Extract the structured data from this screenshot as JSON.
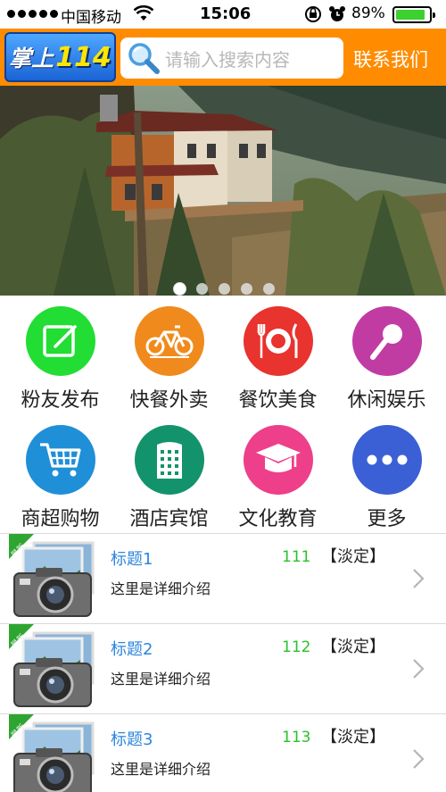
{
  "status_bar": {
    "carrier": "中国移动",
    "time": "15:06",
    "battery_percent": "89%",
    "battery_level": 0.89
  },
  "header": {
    "logo_text_1": "掌上",
    "logo_text_2": "114",
    "search_placeholder": "请输入搜索内容",
    "contact_label": "联系我们",
    "bar_color": "#ff8c00"
  },
  "banner": {
    "slide_count": 5,
    "active_slide": 1
  },
  "categories": [
    {
      "label": "粉友发布",
      "icon": "edit-icon",
      "color": "#22dd33"
    },
    {
      "label": "快餐外卖",
      "icon": "bicycle-icon",
      "color": "#f08a1c"
    },
    {
      "label": "餐饮美食",
      "icon": "dining-icon",
      "color": "#e8332e"
    },
    {
      "label": "休闲娱乐",
      "icon": "microphone-icon",
      "color": "#c03ca3"
    },
    {
      "label": "商超购物",
      "icon": "shopping-cart-icon",
      "color": "#1f8fd8"
    },
    {
      "label": "酒店宾馆",
      "icon": "hotel-icon",
      "color": "#13936b"
    },
    {
      "label": "文化教育",
      "icon": "graduation-cap-icon",
      "color": "#ee3f8a"
    },
    {
      "label": "更多",
      "icon": "more-icon",
      "color": "#3b5fd4"
    }
  ],
  "list": [
    {
      "badge": "最新",
      "title": "标题1",
      "number": "111",
      "tag": "【淡定】",
      "desc": "这里是详细介绍"
    },
    {
      "badge": "最新",
      "title": "标题2",
      "number": "112",
      "tag": "【淡定】",
      "desc": "这里是详细介绍"
    },
    {
      "badge": "最新",
      "title": "标题3",
      "number": "113",
      "tag": "【淡定】",
      "desc": "这里是详细介绍"
    }
  ]
}
